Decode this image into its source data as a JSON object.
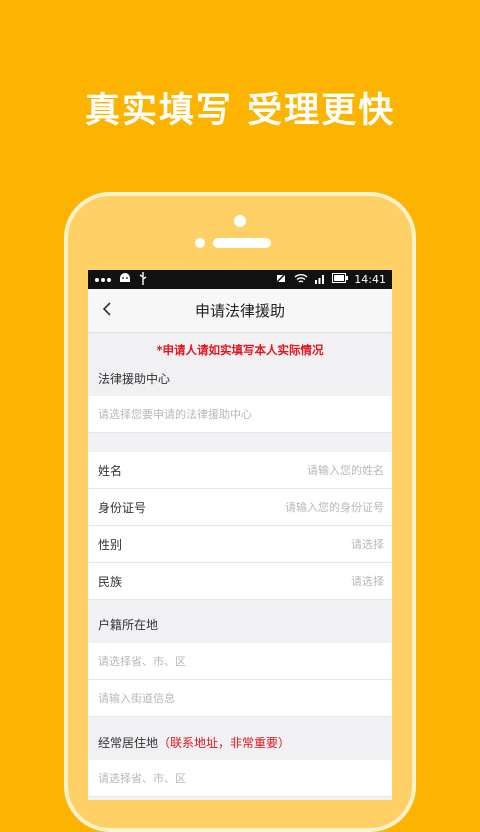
{
  "headline": "真实填写  受理更快",
  "status_bar": {
    "time": "14:41"
  },
  "nav": {
    "title": "申请法律援助"
  },
  "notice": "*申请人请如实填写本人实际情况",
  "legal_center": {
    "label": "法律援助中心",
    "placeholder": "请选择您要申请的法律援助中心"
  },
  "fields": {
    "name": {
      "label": "姓名",
      "placeholder": "请输入您的姓名"
    },
    "id_number": {
      "label": "身份证号",
      "placeholder": "请输入您的身份证号"
    },
    "gender": {
      "label": "性别",
      "value": "请选择"
    },
    "ethnicity": {
      "label": "民族",
      "value": "请选择"
    }
  },
  "household": {
    "label": "户籍所在地",
    "region_placeholder": "请选择省、市、区",
    "street_placeholder": "请输入街道信息"
  },
  "residence": {
    "label": "经常居住地",
    "hint": "（联系地址，非常重要）",
    "region_placeholder": "请选择省、市、区"
  },
  "colors": {
    "background": "#FDB400",
    "phone_frame": "#FFD066",
    "notice_red": "#E4151C"
  }
}
